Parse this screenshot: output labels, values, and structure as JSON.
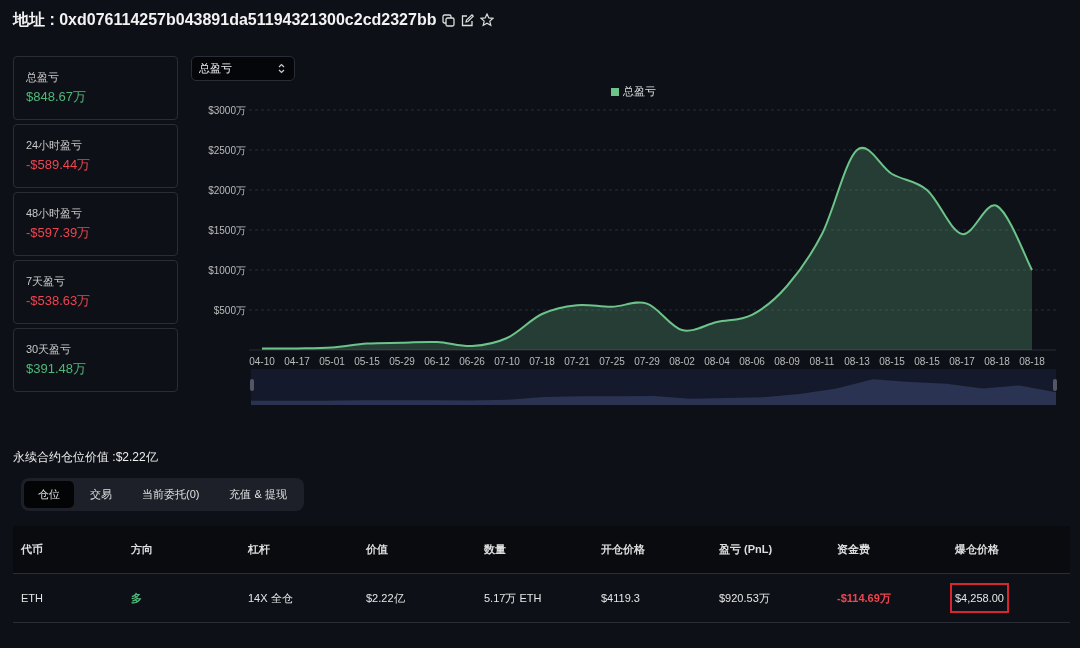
{
  "title": "地址 : 0xd076114257b043891da51194321300c2cd2327bb",
  "stats": [
    {
      "label": "总盈亏",
      "value": "$848.67万",
      "color": "#4fb878"
    },
    {
      "label": "24小时盈亏",
      "value": "-$589.44万",
      "color": "#f0444f"
    },
    {
      "label": "48小时盈亏",
      "value": "-$597.39万",
      "color": "#f0444f"
    },
    {
      "label": "7天盈亏",
      "value": "-$538.63万",
      "color": "#f0444f"
    },
    {
      "label": "30天盈亏",
      "value": "$391.48万",
      "color": "#4fb878"
    }
  ],
  "dropdown": {
    "value": "总盈亏"
  },
  "chart_data": {
    "type": "area",
    "grid": true,
    "categories": [
      "04-10",
      "04-17",
      "05-01",
      "05-15",
      "05-29",
      "06-12",
      "06-26",
      "07-10",
      "07-18",
      "07-21",
      "07-25",
      "07-29",
      "08-02",
      "08-04",
      "08-06",
      "08-09",
      "08-11",
      "08-13",
      "08-15",
      "08-15",
      "08-17",
      "08-18",
      "08-18"
    ],
    "series": [
      {
        "name": "总盈亏",
        "color": "#6cc48a",
        "values": [
          20,
          20,
          30,
          80,
          90,
          100,
          50,
          150,
          450,
          560,
          540,
          580,
          250,
          350,
          440,
          800,
          1450,
          2500,
          2200,
          2000,
          1450,
          1800,
          1000
        ]
      }
    ],
    "ylim": [
      0,
      3000
    ],
    "yticks": [
      {
        "value": 500,
        "label": "$500万"
      },
      {
        "value": 1000,
        "label": "$1000万"
      },
      {
        "value": 1500,
        "label": "$1500万"
      },
      {
        "value": 2000,
        "label": "$2000万"
      },
      {
        "value": 2500,
        "label": "$2500万"
      },
      {
        "value": 3000,
        "label": "$3000万"
      }
    ]
  },
  "section_title": "永续合约仓位价值 :$2.22亿",
  "tabs": [
    {
      "label": "仓位",
      "selected": true
    },
    {
      "label": "交易",
      "selected": false
    },
    {
      "label": "当前委托(0)",
      "selected": false
    },
    {
      "label": "充值 & 提现",
      "selected": false
    }
  ],
  "table": {
    "columns": [
      "代币",
      "方向",
      "杠杆",
      "价值",
      "数量",
      "开仓价格",
      "盈亏 (PnL)",
      "资金费",
      "爆仓价格"
    ],
    "rows": [
      {
        "cells": [
          {
            "text": "ETH",
            "highlighted": false
          },
          {
            "text": "多",
            "color": "#4fb878",
            "highlighted": false
          },
          {
            "text": "14X 全仓",
            "highlighted": false
          },
          {
            "text": "$2.22亿",
            "highlighted": false
          },
          {
            "text": "5.17万 ETH",
            "highlighted": false
          },
          {
            "text": "$4119.3",
            "highlighted": false
          },
          {
            "text": "$920.53万",
            "highlighted": false
          },
          {
            "text": "-$114.69万",
            "color": "#f0444f",
            "highlighted": false
          },
          {
            "text": "$4,258.00",
            "highlighted": true
          }
        ]
      }
    ]
  }
}
